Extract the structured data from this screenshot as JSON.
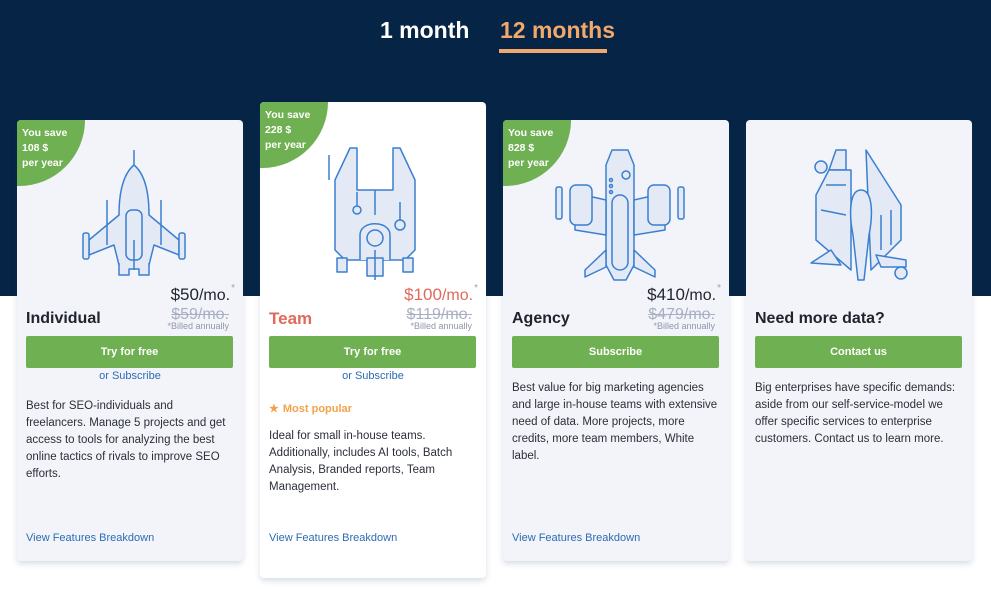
{
  "billing_tabs": [
    {
      "label": "1 month",
      "active": false
    },
    {
      "label": "12 months",
      "active": true
    }
  ],
  "colors": {
    "background_dark": "#062445",
    "accent_orange": "#f1a86a",
    "green": "#6fb052",
    "team_red": "#e0685c",
    "link_blue": "#2d6bb3"
  },
  "plans": [
    {
      "name": "Individual",
      "save_line1": "You save",
      "save_line2": "108 $",
      "save_line3": "per year",
      "price": "$50",
      "per": "/mo.",
      "asterisk": "*",
      "old_price": "$59/mo.",
      "billed": "*Billed annually",
      "button": "Try for free",
      "or_subscribe": "or Subscribe",
      "description": "Best for SEO-individuals and freelancers. Manage 5 projects and get access to tools for analyzing the best online tactics of rivals to improve SEO efforts.",
      "features_link": "View Features Breakdown",
      "icon": "spaceship-icon"
    },
    {
      "name": "Team",
      "save_line1": "You save",
      "save_line2": "228 $",
      "save_line3": "per year",
      "price": "$100",
      "per": "/mo.",
      "asterisk": "*",
      "old_price": "$119/mo.",
      "billed": "*Billed annually",
      "button": "Try for free",
      "or_subscribe": "or Subscribe",
      "popular_label": "Most popular",
      "description": "Ideal for small in-house teams. Additionally, includes AI tools, Batch Analysis, Branded reports, Team Management.",
      "features_link": "View Features Breakdown",
      "icon": "spaceship-icon"
    },
    {
      "name": "Agency",
      "save_line1": "You save",
      "save_line2": "828 $",
      "save_line3": "per year",
      "price": "$410",
      "per": "/mo.",
      "asterisk": "*",
      "old_price": "$479/mo.",
      "billed": "*Billed annually",
      "button": "Subscribe",
      "description": "Best value for big marketing agencies and large in-house teams with extensive need of data. More projects, more credits, more team members, White label.",
      "features_link": "View Features Breakdown",
      "icon": "spaceship-icon"
    },
    {
      "name": "Need more data?",
      "button": "Contact us",
      "description": "Big enterprises have specific demands: aside from our self-service-model we offer specific services to enterprise customers. Contact us to learn more.",
      "icon": "spaceship-icon"
    }
  ]
}
